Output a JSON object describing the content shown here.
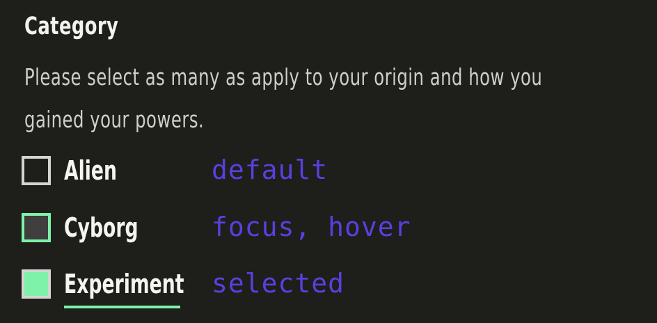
{
  "fieldset": {
    "legend": "Category",
    "hint_line1": "Please select as many as apply to your origin and how you",
    "hint_line2": "gained your powers."
  },
  "options": [
    {
      "label": "Alien",
      "state_note": "default",
      "checked": false,
      "focused": false
    },
    {
      "label": "Cyborg",
      "state_note": "focus, hover",
      "checked": false,
      "focused": true
    },
    {
      "label": "Experiment",
      "state_note": "selected",
      "checked": true,
      "focused": false
    }
  ],
  "colors": {
    "background": "#1e1e1a",
    "accent_green": "#7ef2a8",
    "annotation_purple": "#5b3fe0",
    "checkbox_border": "#d4d4d4",
    "hover_fill": "#3f3f3d",
    "text_primary": "#f4f4f0",
    "text_secondary": "#cfcfc9"
  }
}
